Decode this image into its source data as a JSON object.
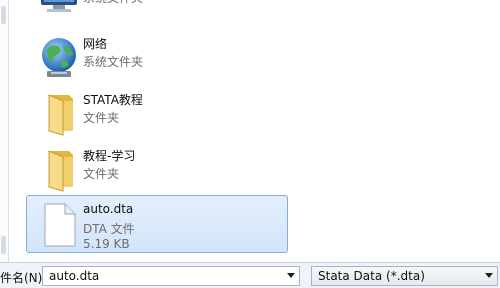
{
  "items": [
    {
      "name": "",
      "type": "系统文件夹",
      "icon": "system-folder-icon"
    },
    {
      "name": "网络",
      "type": "系统文件夹",
      "icon": "network-globe-icon"
    },
    {
      "name": "STATA教程",
      "type": "文件夹",
      "icon": "folder-icon"
    },
    {
      "name": "教程-学习",
      "type": "文件夹",
      "icon": "folder-icon"
    },
    {
      "name": "auto.dta",
      "type": "DTA 文件",
      "size": "5.19 KB",
      "icon": "document-icon",
      "selected": true
    }
  ],
  "bottom": {
    "filename_label": "件名(N):",
    "filename_value": "auto.dta",
    "filetype_value": "Stata Data (*.dta)"
  },
  "colors": {
    "selection_fill": "#d9e8fb",
    "selection_border": "#84acdd",
    "folder_yellow": "#f1cf6a"
  }
}
